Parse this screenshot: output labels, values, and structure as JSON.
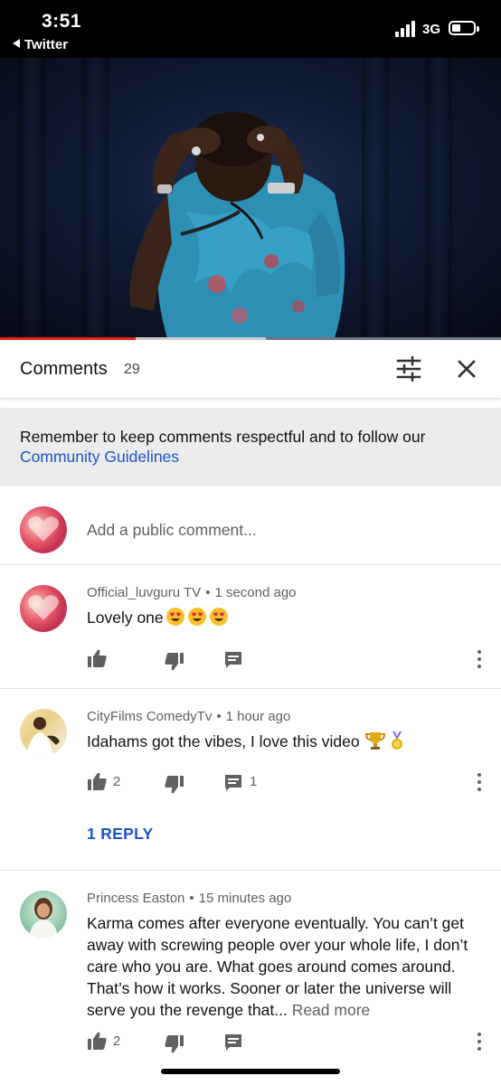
{
  "status_bar": {
    "time": "3:51",
    "back_app": "Twitter",
    "network": "3G"
  },
  "video": {
    "progress_played_fraction": 0.27,
    "progress_buffered_fraction": 0.53,
    "accent_color": "#e62117"
  },
  "comments_panel": {
    "title": "Comments",
    "count": "29",
    "notice_text": "Remember to keep comments respectful and to follow our",
    "notice_link": "Community Guidelines",
    "add_comment_placeholder": "Add a public comment..."
  },
  "comments": [
    {
      "author": "Official_luvguru TV",
      "time": "1 second ago",
      "text": "Lovely one",
      "emoji": [
        "heart-eyes",
        "heart-eyes",
        "heart-eyes"
      ],
      "likes": "",
      "replies": ""
    },
    {
      "author": "CityFilms ComedyTv",
      "time": "1 hour ago",
      "text": "Idahams got the vibes, I love this video",
      "emoji": [
        "trophy",
        "medal"
      ],
      "likes": "2",
      "replies": "1",
      "reply_link": "1 REPLY"
    },
    {
      "author": "Princess Easton",
      "time": "15 minutes ago",
      "text": "Karma comes after everyone eventually. You can’t get away with screwing people over your whole life, I don’t care who you are. What goes around comes around. That’s how it works. Sooner or later the universe will serve you the revenge that...",
      "read_more": "Read more",
      "likes": "2",
      "replies": ""
    }
  ],
  "colors": {
    "link_blue": "#1a55c7",
    "muted_text": "#606060",
    "notice_bg": "#ececec"
  }
}
